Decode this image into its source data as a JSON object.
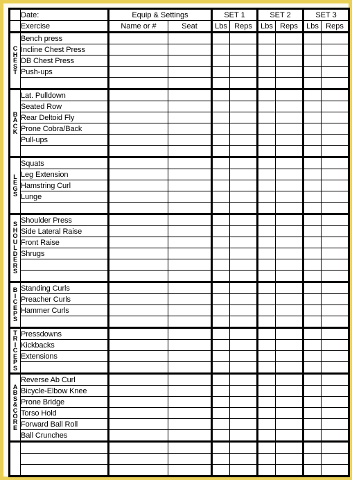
{
  "document": {
    "kind": "workout-log-sheet",
    "border_color": "#e9cf55",
    "page_color": "#fdfbf2"
  },
  "header": {
    "row1": {
      "date_label": "Date:",
      "equip_group": "Equip & Settings",
      "sets": [
        "SET 1",
        "SET 2",
        "SET 3"
      ]
    },
    "row2": {
      "exercise_label": "Exercise",
      "name_or_number": "Name or #",
      "seat": "Seat",
      "lbs": "Lbs",
      "reps": "Reps"
    }
  },
  "sections": [
    {
      "category": "CHEST",
      "letters": [
        "C",
        "H",
        "E",
        "S",
        "T"
      ],
      "exercises": [
        "Bench press",
        "Incline Chest Press",
        "DB Chest Press",
        "Push-ups"
      ],
      "blank_rows": 1
    },
    {
      "category": "BACK",
      "letters": [
        "B",
        "A",
        "C",
        "K"
      ],
      "exercises": [
        "Lat. Pulldown",
        "Seated Row",
        "Rear Deltoid Fly",
        "Prone Cobra/Back",
        "Pull-ups"
      ],
      "blank_rows": 1
    },
    {
      "category": "LEGS",
      "letters": [
        "L",
        "E",
        "G",
        "S"
      ],
      "exercises": [
        "Squats",
        "Leg Extension",
        "Hamstring Curl",
        "Lunge"
      ],
      "blank_rows": 1
    },
    {
      "category": "SHOULDERS",
      "letters": [
        "S",
        "H",
        "O",
        "U",
        "L",
        "D",
        "E",
        "R",
        "S"
      ],
      "exercises": [
        "Shoulder Press",
        "Side Lateral Raise",
        "Front Raise",
        "Shrugs"
      ],
      "blank_rows": 2
    },
    {
      "category": "BICEPS",
      "letters": [
        "B",
        "I",
        "C",
        "E",
        "P",
        "S"
      ],
      "exercises": [
        "Standing Curls",
        "Preacher Curls",
        "Hammer Curls"
      ],
      "blank_rows": 1
    },
    {
      "category": "TRICEPS",
      "letters": [
        "T",
        "R",
        "I",
        "C",
        "E",
        "P",
        "S"
      ],
      "exercises": [
        "Pressdowns",
        "Kickbacks",
        "Extensions"
      ],
      "blank_rows": 1
    },
    {
      "category": "ABS & CORE",
      "letters": [
        "A",
        "B",
        "S",
        "&",
        "C",
        "O",
        "R",
        "E"
      ],
      "exercises": [
        "Reverse Ab Curl",
        "Bicycle-Elbow Knee",
        "Prone Bridge",
        "Torso Hold",
        "Forward Ball Roll",
        "Ball Crunches"
      ],
      "blank_rows": 0
    },
    {
      "category": "",
      "letters": [],
      "exercises": [],
      "blank_rows": 3
    }
  ]
}
